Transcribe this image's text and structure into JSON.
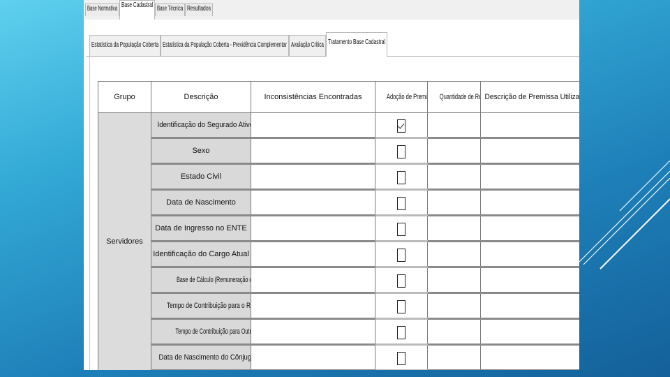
{
  "top_tabs": [
    {
      "label": "Base Normativa",
      "active": false
    },
    {
      "label": "Base Cadastral",
      "active": true
    },
    {
      "label": "Base Técnica",
      "active": false
    },
    {
      "label": "Resultados",
      "active": false
    }
  ],
  "sub_tabs": [
    {
      "label": "Estatística da População Coberta",
      "active": false
    },
    {
      "label": "Estatística da População Coberta - Previdência Complementar",
      "active": false
    },
    {
      "label": "Avaliação Crítica",
      "active": false
    },
    {
      "label": "Tratamento Base Cadastral",
      "active": true
    }
  ],
  "table": {
    "headers": [
      "Grupo",
      "Descrição",
      "Inconsistências Encontradas",
      "Adoção de Premissa",
      "Quantidade de Reg...",
      "Descrição de Premissa Utilizada"
    ],
    "group": "Servidores",
    "rows": [
      {
        "descricao": "Identificação do Segurado Ativo",
        "adocao_checked": true
      },
      {
        "descricao": "Sexo",
        "adocao_checked": false
      },
      {
        "descricao": "Estado Civil",
        "adocao_checked": false
      },
      {
        "descricao": "Data de Nascimento",
        "adocao_checked": false
      },
      {
        "descricao": "Data de Ingresso no ENTE",
        "adocao_checked": false
      },
      {
        "descricao": "Identificação do Cargo Atual",
        "adocao_checked": false
      },
      {
        "descricao": "Base de Cálculo (Remuneração de Contrib",
        "adocao_checked": false
      },
      {
        "descricao": "Tempo de Contribuição para o RGPS",
        "adocao_checked": false
      },
      {
        "descricao": "Tempo de Contribuição para Outros RPPS",
        "adocao_checked": false
      },
      {
        "descricao": "Data de Nascimento do Cônjuge",
        "adocao_checked": false
      }
    ]
  }
}
